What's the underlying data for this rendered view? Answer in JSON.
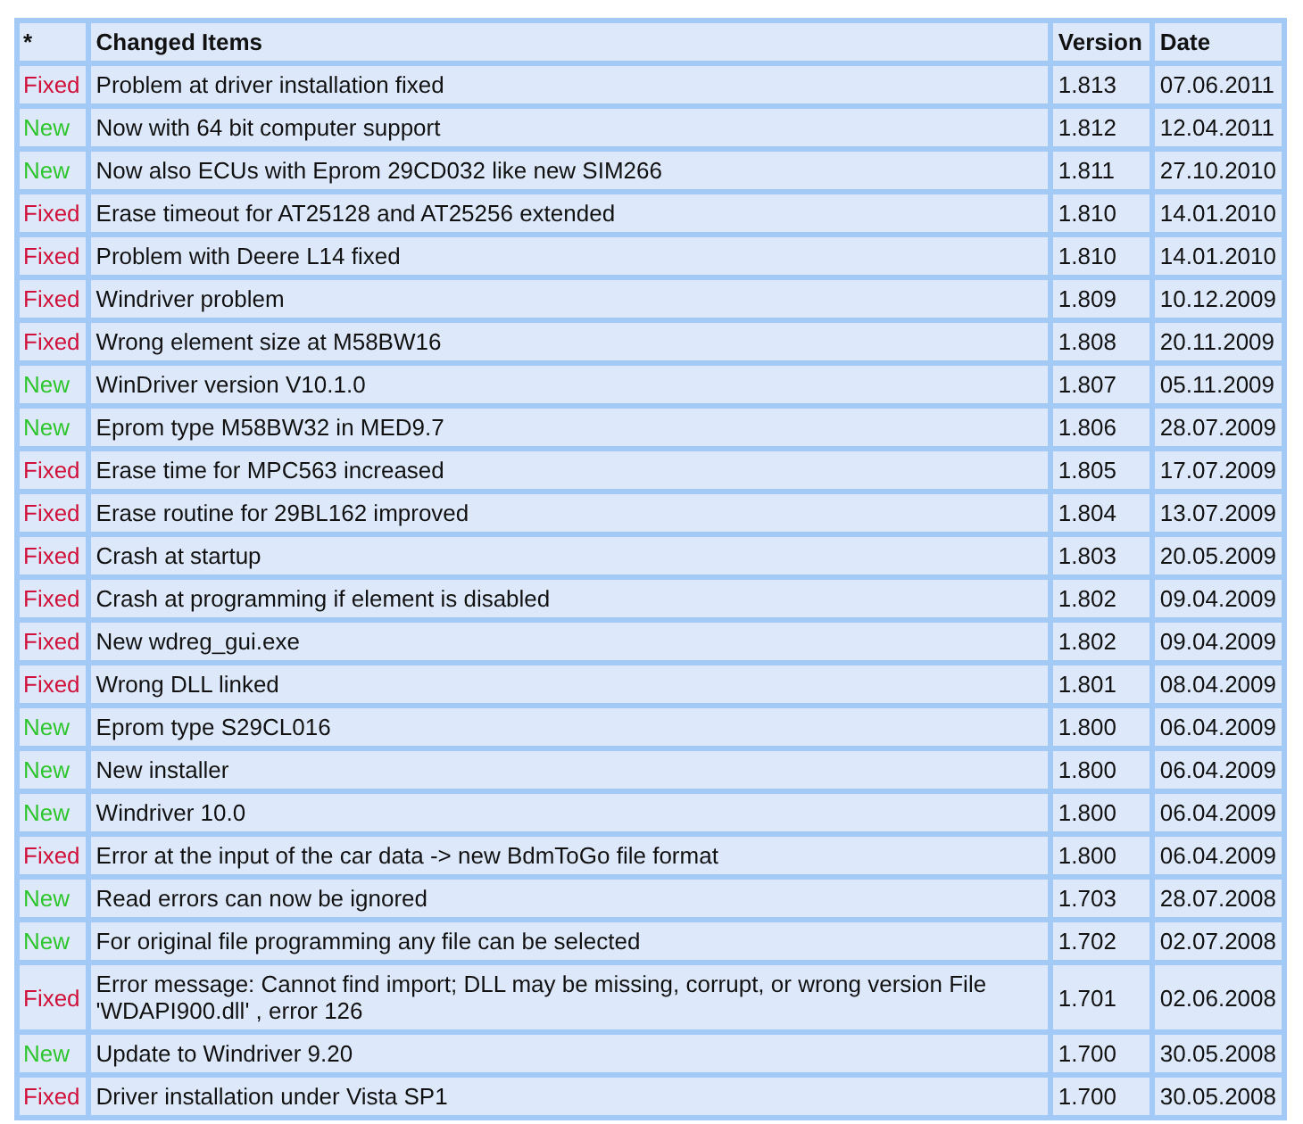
{
  "table": {
    "columns": [
      "*",
      "Changed Items",
      "Version",
      "Date"
    ],
    "rows": [
      {
        "kind": "fixed",
        "status": "Fixed",
        "item": "Problem at driver installation fixed",
        "version": "1.813",
        "date": "07.06.2011"
      },
      {
        "kind": "new",
        "status": "New",
        "item": "Now with 64 bit computer support",
        "version": "1.812",
        "date": "12.04.2011"
      },
      {
        "kind": "new",
        "status": "New",
        "item": "Now also ECUs with Eprom 29CD032 like new SIM266",
        "version": "1.811",
        "date": "27.10.2010"
      },
      {
        "kind": "fixed",
        "status": "Fixed",
        "item": "Erase timeout for AT25128 and AT25256 extended",
        "version": "1.810",
        "date": "14.01.2010"
      },
      {
        "kind": "fixed",
        "status": "Fixed",
        "item": "Problem with Deere L14 fixed",
        "version": "1.810",
        "date": "14.01.2010"
      },
      {
        "kind": "fixed",
        "status": "Fixed",
        "item": "Windriver problem",
        "version": "1.809",
        "date": "10.12.2009"
      },
      {
        "kind": "fixed",
        "status": "Fixed",
        "item": "Wrong element size at M58BW16",
        "version": "1.808",
        "date": "20.11.2009"
      },
      {
        "kind": "new",
        "status": "New",
        "item": "WinDriver version V10.1.0",
        "version": "1.807",
        "date": "05.11.2009"
      },
      {
        "kind": "new",
        "status": "New",
        "item": "Eprom type M58BW32 in MED9.7",
        "version": "1.806",
        "date": "28.07.2009"
      },
      {
        "kind": "fixed",
        "status": "Fixed",
        "item": "Erase time for MPC563 increased",
        "version": "1.805",
        "date": "17.07.2009"
      },
      {
        "kind": "fixed",
        "status": "Fixed",
        "item": "Erase routine for 29BL162 improved",
        "version": "1.804",
        "date": "13.07.2009"
      },
      {
        "kind": "fixed",
        "status": "Fixed",
        "item": "Crash at startup",
        "version": "1.803",
        "date": "20.05.2009"
      },
      {
        "kind": "fixed",
        "status": "Fixed",
        "item": "Crash at programming if element is disabled",
        "version": "1.802",
        "date": "09.04.2009"
      },
      {
        "kind": "fixed",
        "status": "Fixed",
        "item": "New wdreg_gui.exe",
        "version": "1.802",
        "date": "09.04.2009"
      },
      {
        "kind": "fixed",
        "status": "Fixed",
        "item": "Wrong DLL linked",
        "version": "1.801",
        "date": "08.04.2009"
      },
      {
        "kind": "new",
        "status": "New",
        "item": "Eprom type S29CL016",
        "version": "1.800",
        "date": "06.04.2009"
      },
      {
        "kind": "new",
        "status": "New",
        "item": "New installer",
        "version": "1.800",
        "date": "06.04.2009"
      },
      {
        "kind": "new",
        "status": "New",
        "item": "Windriver 10.0",
        "version": "1.800",
        "date": "06.04.2009"
      },
      {
        "kind": "fixed",
        "status": "Fixed",
        "item": "Error at the input of the car data -> new BdmToGo file format",
        "version": "1.800",
        "date": "06.04.2009"
      },
      {
        "kind": "new",
        "status": "New",
        "item": "Read errors can now be ignored",
        "version": "1.703",
        "date": "28.07.2008"
      },
      {
        "kind": "new",
        "status": "New",
        "item": "For original file programming any file can be selected",
        "version": "1.702",
        "date": "02.07.2008"
      },
      {
        "kind": "fixed",
        "status": "Fixed",
        "item": "Error message: Cannot find import; DLL may be missing, corrupt, or wrong version File 'WDAPI900.dll' , error 126",
        "version": "1.701",
        "date": "02.06.2008"
      },
      {
        "kind": "new",
        "status": "New",
        "item": "Update to Windriver 9.20",
        "version": "1.700",
        "date": "30.05.2008"
      },
      {
        "kind": "fixed",
        "status": "Fixed",
        "item": "Driver installation under Vista SP1",
        "version": "1.700",
        "date": "30.05.2008"
      }
    ]
  }
}
